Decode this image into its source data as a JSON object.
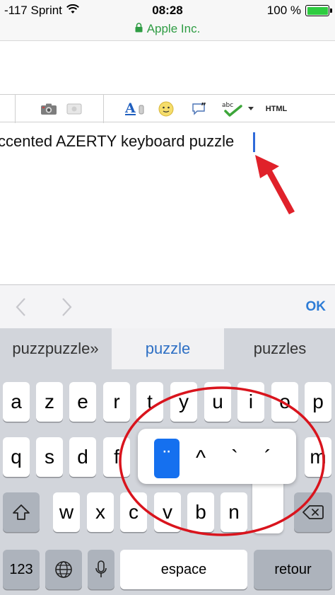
{
  "status_bar": {
    "carrier": "-117 Sprint",
    "time": "08:28",
    "battery": "100 %",
    "battery_level": 1.0,
    "site": "Apple Inc.",
    "site_color": "#2e9c43"
  },
  "toolbar": {
    "buttons": [
      {
        "icon": "camera-icon"
      },
      {
        "icon": "image-icon"
      },
      {
        "icon": "font-color-icon"
      },
      {
        "icon": "emoji-icon"
      },
      {
        "icon": "quote-icon"
      },
      {
        "icon": "spellcheck-icon"
      },
      {
        "icon": "dropdown-arrow-icon"
      }
    ],
    "html_label": "HTML"
  },
  "editor": {
    "text": "ccented AZERTY keyboard puzzle",
    "caret_color": "#2f6ad9"
  },
  "annotations": {
    "arrow_color": "#e0212a",
    "circle_color": "#d9141d"
  },
  "accessory_bar": {
    "prev_icon": "chevron-left-icon",
    "next_icon": "chevron-right-icon",
    "ok_label": "OK"
  },
  "keyboard": {
    "suggestions": [
      "puzzpuzzle»",
      "puzzle",
      "puzzles"
    ],
    "row1": [
      "a",
      "z",
      "e",
      "r",
      "t",
      "y",
      "u",
      "i",
      "o",
      "p"
    ],
    "row2": [
      "q",
      "s",
      "d",
      "f",
      "",
      "",
      "",
      "",
      "",
      "m"
    ],
    "row3": [
      "w",
      "x",
      "c",
      "v",
      "b",
      "n",
      ""
    ],
    "shift_icon": "shift-icon",
    "delete_icon": "delete-icon",
    "numbers_label": "123",
    "globe_icon": "globe-icon",
    "mic_icon": "microphone-icon",
    "space_label": "espace",
    "return_label": "retour",
    "accent_popup": [
      "¨",
      "^",
      "`",
      "´"
    ],
    "accent_selected": 0
  }
}
